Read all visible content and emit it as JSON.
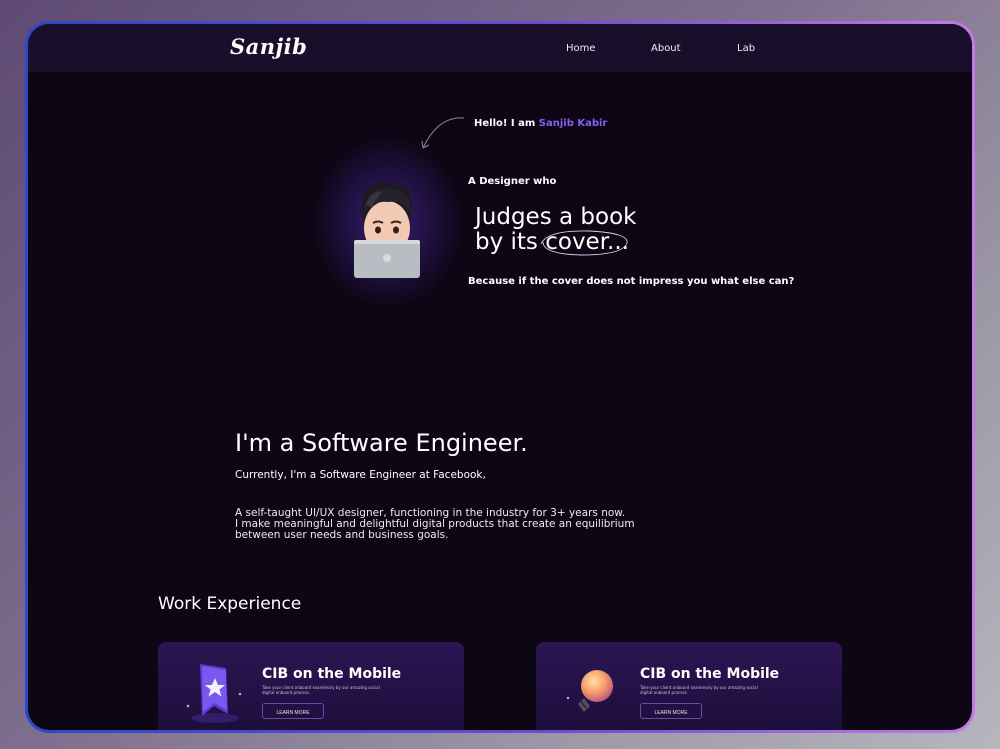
{
  "nav": {
    "logo": "Sanjib",
    "items": [
      {
        "label": "Home"
      },
      {
        "label": "About"
      },
      {
        "label": "Lab"
      }
    ]
  },
  "hero": {
    "hello_prefix": "Hello! I am",
    "name": "Sanjib Kabir",
    "designer_who": "A Designer who",
    "headline_line1": "Judges a book",
    "headline_line2": "by its cover...",
    "because": "Because if the cover does not impress you what else can?"
  },
  "about": {
    "title": "I'm a Software Engineer.",
    "currently": "Currently, I'm a Software Engineer at Facebook,",
    "bio_line1": "A self-taught UI/UX designer, functioning in the industry for 3+ years now.",
    "bio_line2": "I make meaningful and delightful digital products that create an equilibrium",
    "bio_line3": "between user needs and business goals."
  },
  "work": {
    "section_title": "Work Experience",
    "cards": [
      {
        "title": "CIB on the Mobile",
        "description": "Take your client onboard seamlessly by our amazing social digital onboard process.",
        "button": "LEARN MORE",
        "icon": "bookmark-star-icon"
      },
      {
        "title": "CIB on the Mobile",
        "description": "Take your client onboard seamlessly by our amazing social digital onboard process.",
        "button": "LEARN MORE",
        "icon": "lightbulb-icon"
      }
    ]
  },
  "colors": {
    "accent": "#8b5cf6",
    "background": "#0d0615",
    "navbar": "#1a0f2a",
    "frame_gradient_start": "#2b49c8",
    "frame_gradient_end": "#c47be6"
  }
}
